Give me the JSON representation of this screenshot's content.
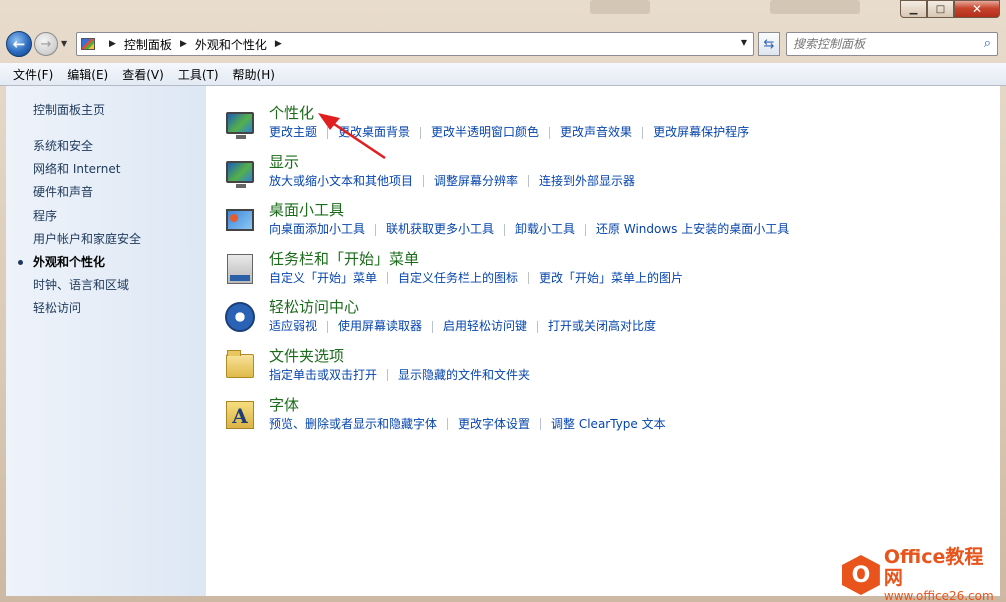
{
  "window": {
    "caption_minimize": "▁",
    "caption_maximize": "□",
    "caption_close": "✕"
  },
  "address_bar": {
    "breadcrumbs": [
      "控制面板",
      "外观和个性化"
    ],
    "search_placeholder": "搜索控制面板"
  },
  "menu": [
    "文件(F)",
    "编辑(E)",
    "查看(V)",
    "工具(T)",
    "帮助(H)"
  ],
  "sidebar": {
    "home": "控制面板主页",
    "items": [
      {
        "label": "系统和安全"
      },
      {
        "label": "网络和 Internet"
      },
      {
        "label": "硬件和声音"
      },
      {
        "label": "程序"
      },
      {
        "label": "用户帐户和家庭安全"
      },
      {
        "label": "外观和个性化",
        "active": true
      },
      {
        "label": "时钟、语言和区域"
      },
      {
        "label": "轻松访问"
      }
    ]
  },
  "categories": [
    {
      "title": "个性化",
      "icon": "personalization-icon",
      "links": [
        "更改主题",
        "更改桌面背景",
        "更改半透明窗口颜色",
        "更改声音效果",
        "更改屏幕保护程序"
      ]
    },
    {
      "title": "显示",
      "icon": "display-icon",
      "links": [
        "放大或缩小文本和其他项目",
        "调整屏幕分辨率",
        "连接到外部显示器"
      ]
    },
    {
      "title": "桌面小工具",
      "icon": "gadgets-icon",
      "links": [
        "向桌面添加小工具",
        "联机获取更多小工具",
        "卸载小工具",
        "还原 Windows 上安装的桌面小工具"
      ]
    },
    {
      "title": "任务栏和「开始」菜单",
      "icon": "taskbar-icon",
      "links": [
        "自定义「开始」菜单",
        "自定义任务栏上的图标",
        "更改「开始」菜单上的图片"
      ]
    },
    {
      "title": "轻松访问中心",
      "icon": "ease-of-access-icon",
      "links": [
        "适应弱视",
        "使用屏幕读取器",
        "启用轻松访问键",
        "打开或关闭高对比度"
      ]
    },
    {
      "title": "文件夹选项",
      "icon": "folder-options-icon",
      "links": [
        "指定单击或双击打开",
        "显示隐藏的文件和文件夹"
      ]
    },
    {
      "title": "字体",
      "icon": "fonts-icon",
      "links": [
        "预览、删除或者显示和隐藏字体",
        "更改字体设置",
        "调整 ClearType 文本"
      ]
    }
  ],
  "watermark": {
    "logo_letter": "O",
    "title": "Office教程网",
    "url": "www.office26.com"
  },
  "colors": {
    "category_title": "#1a6b1a",
    "link": "#0645ad",
    "annotation_arrow": "#e02020",
    "watermark": "#e8541b"
  }
}
